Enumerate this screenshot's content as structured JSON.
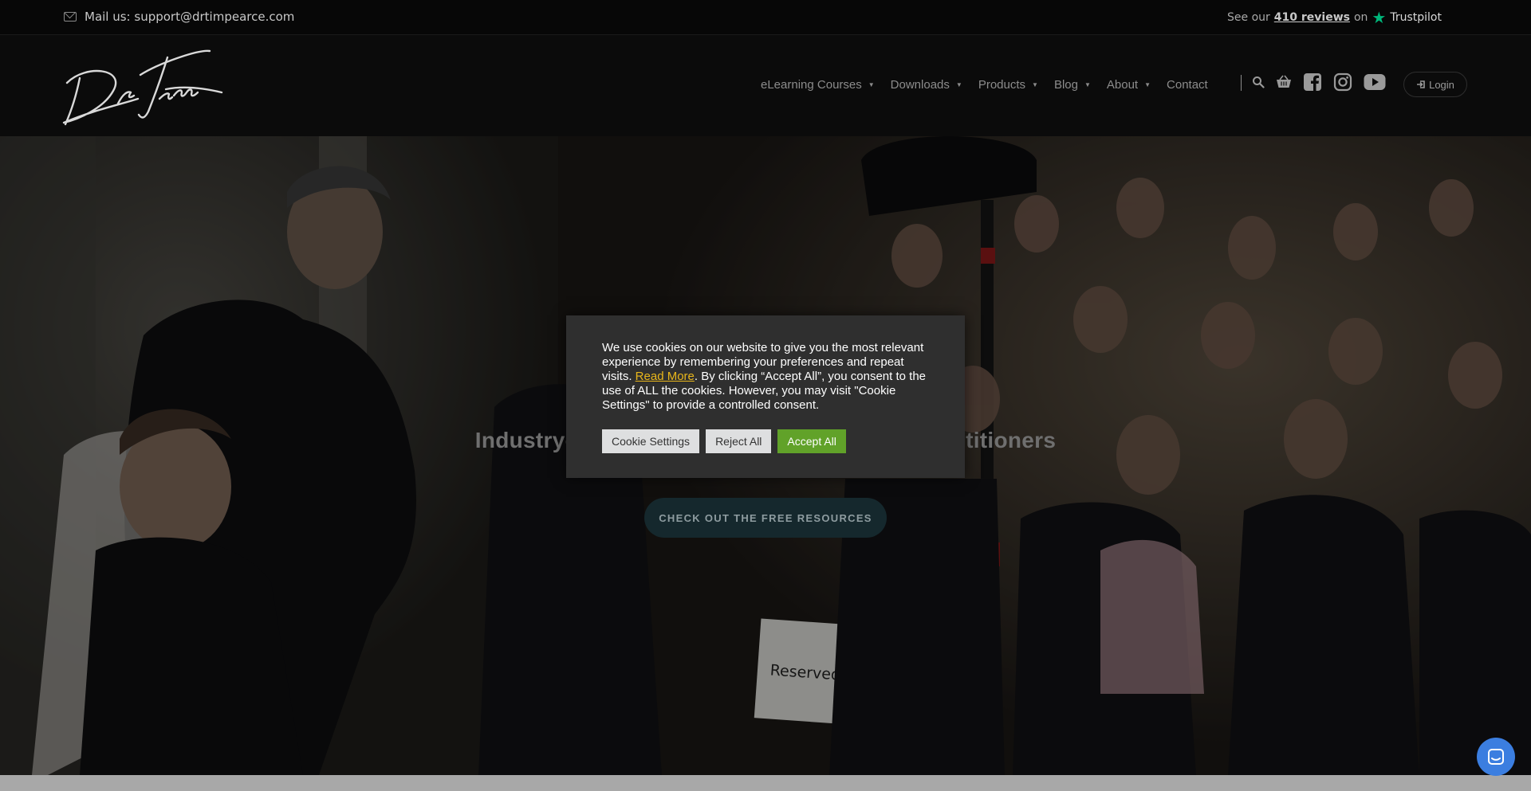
{
  "topbar": {
    "mail": "Mail us: support@drtimpearce.com",
    "reviews_prefix": "See our",
    "reviews_count": "410 reviews",
    "reviews_on": "on",
    "reviews_brand": "Trustpilot"
  },
  "header": {
    "nav": [
      {
        "label": "eLearning Courses",
        "dropdown": true
      },
      {
        "label": "Downloads",
        "dropdown": true
      },
      {
        "label": "Products",
        "dropdown": true
      },
      {
        "label": "Blog",
        "dropdown": true
      },
      {
        "label": "About",
        "dropdown": true
      },
      {
        "label": "Contact",
        "dropdown": false
      }
    ],
    "login_label": "Login",
    "icons": [
      "search-icon",
      "basket-icon",
      "facebook-icon",
      "instagram-icon",
      "youtube-icon"
    ]
  },
  "hero": {
    "title_left": "Industry-",
    "title_right": "ctitioners",
    "cta_label": "CHECK OUT THE FREE RESOURCES"
  },
  "cookie": {
    "text_before": "We use cookies on our website to give you the most relevant experience by remembering your preferences and repeat visits.",
    "read_more": "Read More",
    "text_after": ". By clicking “Accept All”, you consent to the use of ALL the cookies. However, you may visit \"Cookie Settings\" to provide a controlled consent.",
    "buttons": {
      "settings": "Cookie Settings",
      "reject": "Reject All",
      "accept": "Accept All"
    }
  },
  "colors": {
    "accept_green": "#61a229",
    "read_more_link": "#e8b61b",
    "trustpilot_star": "#00b67a",
    "chat_blue": "#3b7ee0"
  }
}
